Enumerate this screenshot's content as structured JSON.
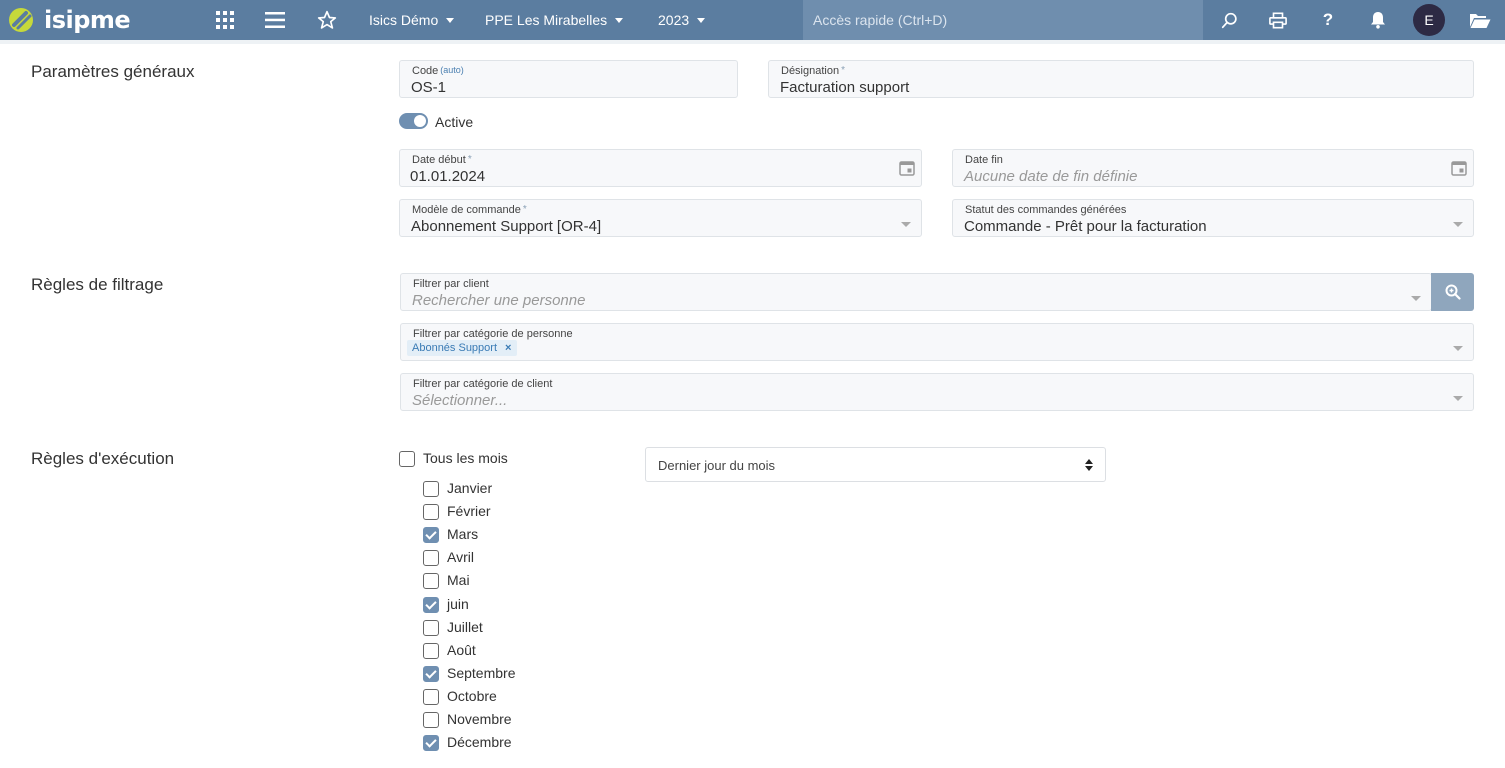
{
  "header": {
    "logo_text": "isipme",
    "company": "Isics Démo",
    "entity": "PPE Les Mirabelles",
    "year": "2023",
    "quick_access_placeholder": "Accès rapide (Ctrl+D)",
    "avatar_initial": "E"
  },
  "general": {
    "title": "Paramètres généraux",
    "code": {
      "label": "Code",
      "badge": "(auto)",
      "value": "OS-1"
    },
    "designation": {
      "label": "Désignation",
      "required": "*",
      "value": "Facturation support"
    },
    "active": {
      "label": "Active",
      "on": true
    },
    "start_date": {
      "label": "Date début",
      "required": "*",
      "value": "01.01.2024"
    },
    "end_date": {
      "label": "Date fin",
      "placeholder": "Aucune date de fin définie"
    },
    "order_model": {
      "label": "Modèle de commande",
      "required": "*",
      "value": "Abonnement Support [OR-4]"
    },
    "order_status": {
      "label": "Statut des commandes générées",
      "value": "Commande - Prêt pour la facturation"
    }
  },
  "filters": {
    "title": "Règles de filtrage",
    "client": {
      "label": "Filtrer par client",
      "placeholder": "Rechercher une personne"
    },
    "person_category": {
      "label": "Filtrer par catégorie de personne",
      "chip": "Abonnés Support",
      "chip_remove": "×"
    },
    "client_category": {
      "label": "Filtrer par catégorie de client",
      "placeholder": "Sélectionner..."
    }
  },
  "execution": {
    "title": "Règles d'exécution",
    "all_months": {
      "label": "Tous les mois",
      "checked": false
    },
    "day_select": "Dernier jour du mois",
    "months": [
      {
        "label": "Janvier",
        "checked": false
      },
      {
        "label": "Février",
        "checked": false
      },
      {
        "label": "Mars",
        "checked": true
      },
      {
        "label": "Avril",
        "checked": false
      },
      {
        "label": "Mai",
        "checked": false
      },
      {
        "label": "juin",
        "checked": true
      },
      {
        "label": "Juillet",
        "checked": false
      },
      {
        "label": "Août",
        "checked": false
      },
      {
        "label": "Septembre",
        "checked": true
      },
      {
        "label": "Octobre",
        "checked": false
      },
      {
        "label": "Novembre",
        "checked": false
      },
      {
        "label": "Décembre",
        "checked": true
      }
    ]
  },
  "colors": {
    "topbar": "#5b7da0",
    "accent": "#6f8fb1"
  }
}
